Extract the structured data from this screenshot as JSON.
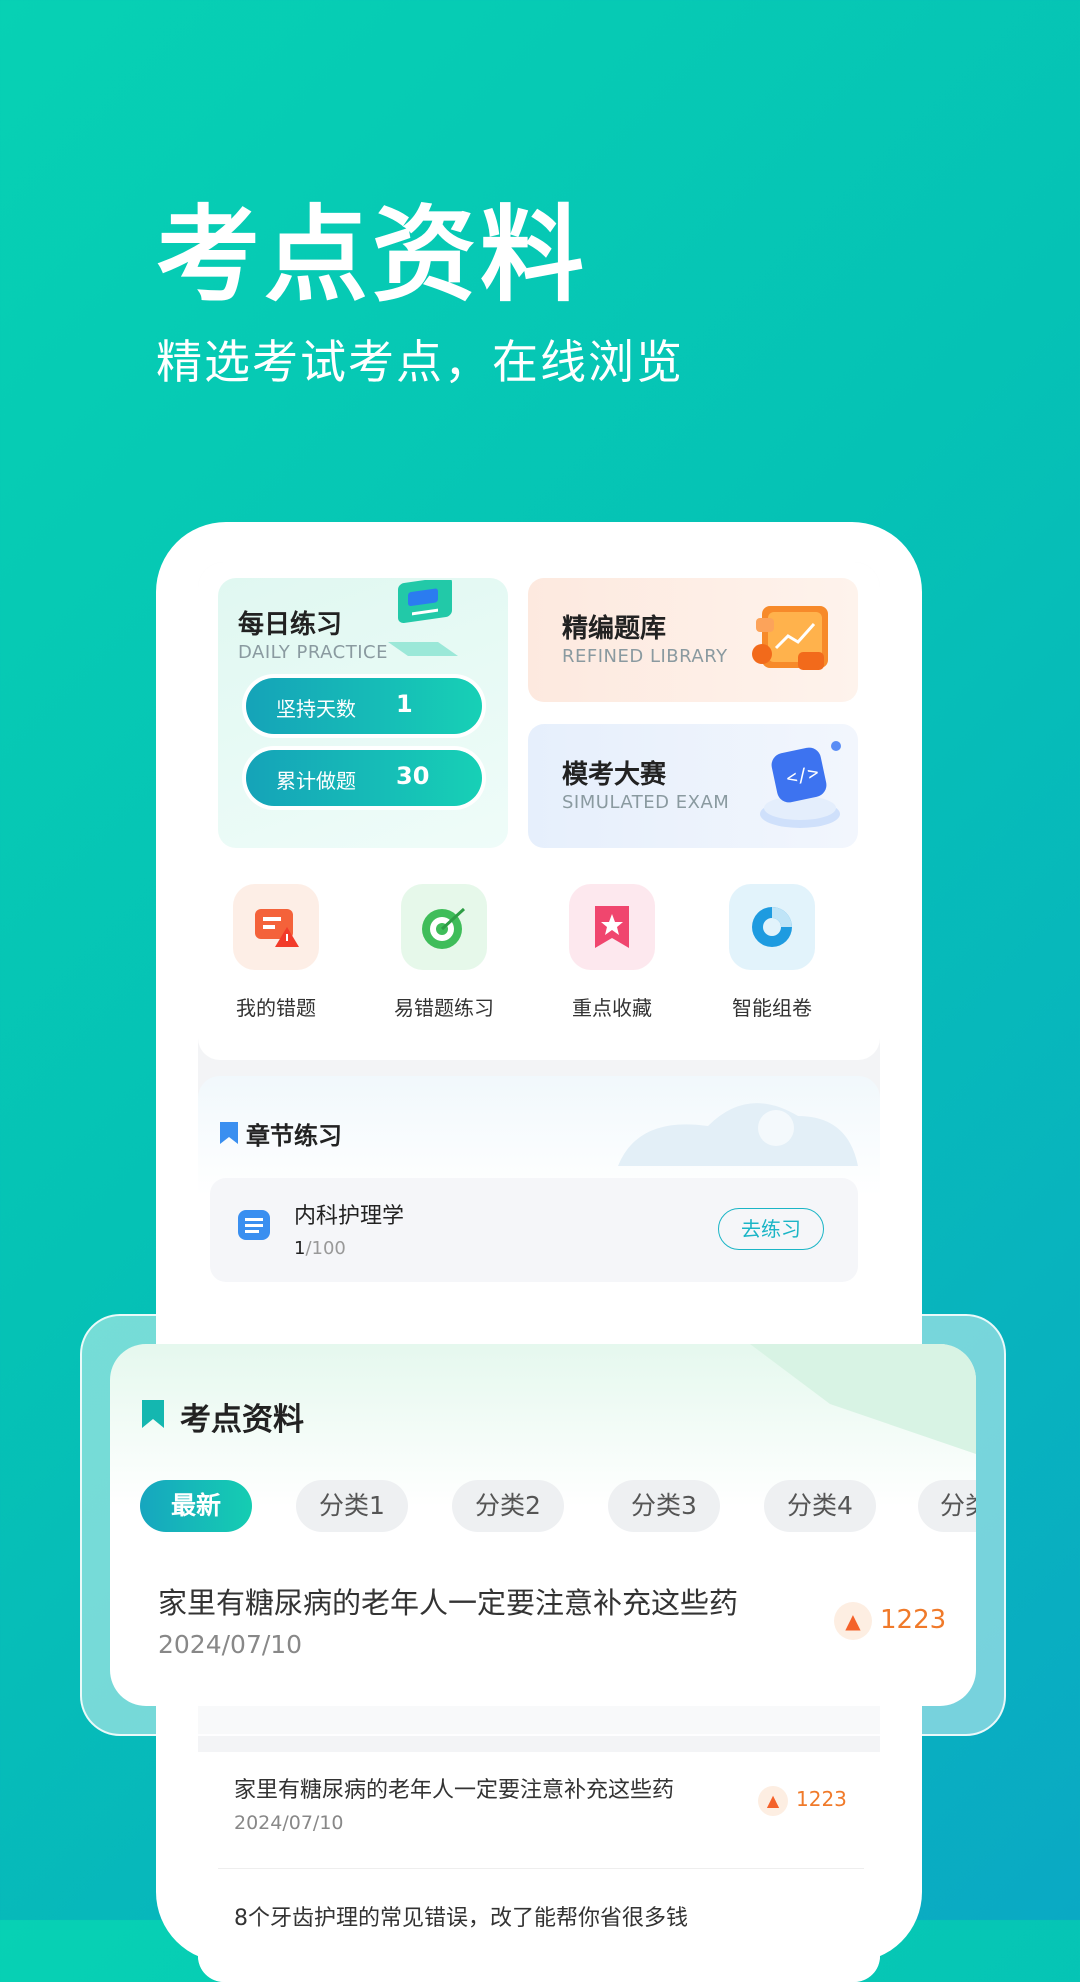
{
  "hero": {
    "title": "考点资料",
    "subtitle": "精选考试考点，在线浏览"
  },
  "daily_practice": {
    "title": "每日练习",
    "subtitle": "DAILY PRACTICE",
    "stats": [
      {
        "label": "坚持天数",
        "value": "1"
      },
      {
        "label": "累计做题",
        "value": "30"
      }
    ]
  },
  "library": {
    "title": "精编题库",
    "subtitle": "REFINED LIBRARY"
  },
  "exam": {
    "title": "模考大赛",
    "subtitle": "SIMULATED EXAM"
  },
  "quick_actions": [
    {
      "label": "我的错题",
      "icon": "wrong-questions-icon",
      "color": "#f4623a"
    },
    {
      "label": "易错题练习",
      "icon": "target-icon",
      "color": "#3fbd5a"
    },
    {
      "label": "重点收藏",
      "icon": "bookmark-star-icon",
      "color": "#f0466e"
    },
    {
      "label": "智能组卷",
      "icon": "pie-chart-icon",
      "color": "#1e9be0"
    }
  ],
  "chapter": {
    "title": "章节练习",
    "item": {
      "name": "内科护理学",
      "progress_done": "1",
      "progress_total": "/100",
      "button": "去练习"
    }
  },
  "materials": {
    "title": "考点资料",
    "tabs": [
      "最新",
      "分类1",
      "分类2",
      "分类3",
      "分类4",
      "分类"
    ],
    "featured": {
      "title": "家里有糖尿病的老年人一定要注意补充这些药",
      "date": "2024/07/10",
      "views": "1223"
    }
  },
  "list": [
    {
      "title": "家里有糖尿病的老年人一定要注意补充这些药",
      "date": "2024/07/10",
      "views": "1223"
    },
    {
      "title": "8个牙齿护理的常见错误，改了能帮你省很多钱"
    }
  ],
  "colors": {
    "accent": "#15c2b5",
    "hot": "#f07a2a"
  }
}
